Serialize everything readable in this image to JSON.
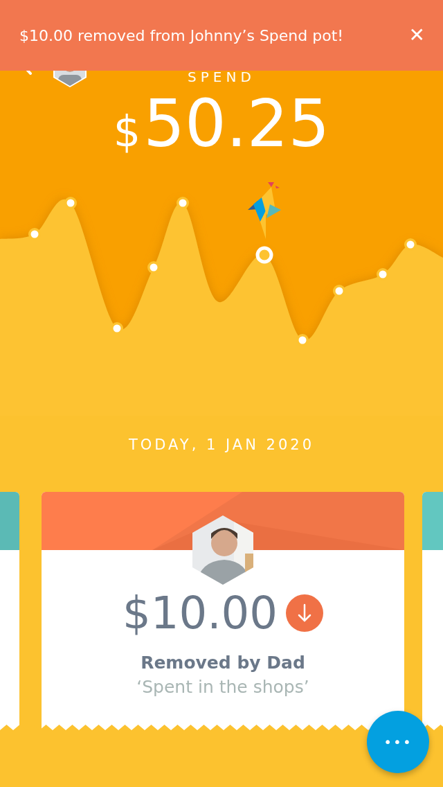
{
  "toast": {
    "message": "$10.00 removed from Johnny’s Spend pot!",
    "close": "✕"
  },
  "header": {
    "title": "SPEND"
  },
  "balance": {
    "currency": "$",
    "amount": "50.25"
  },
  "date": "TODAY, 1 JAN 2020",
  "cards": [
    {
      "kind": "side",
      "color": "#5bbab5"
    },
    {
      "kind": "transaction",
      "color": "#fe7d4c",
      "amount": "$10.00",
      "withdrawal": true,
      "title": "Removed by Dad",
      "note": "‘Spent in the shops’"
    },
    {
      "kind": "side",
      "color": "#62c7c0"
    }
  ],
  "fab": {
    "label": "•••"
  }
}
